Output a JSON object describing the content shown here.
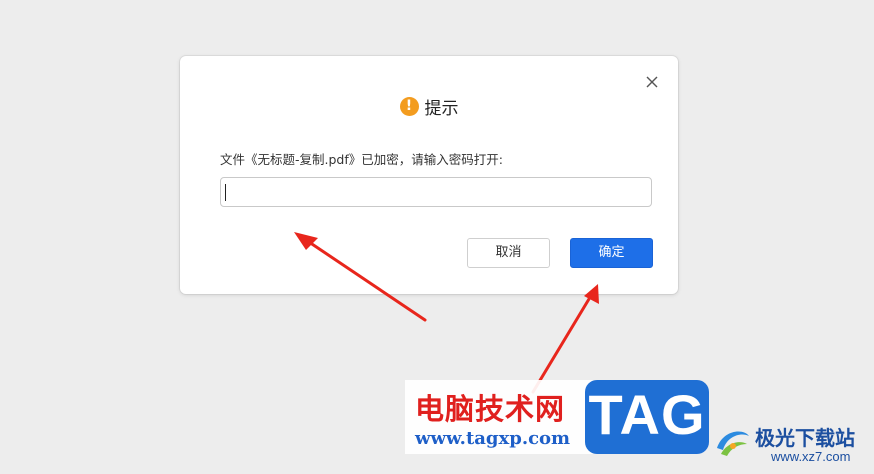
{
  "dialog": {
    "title": "提示",
    "icon": "warning-icon",
    "prompt": "文件《无标题-复制.pdf》已加密，请输入密码打开:",
    "password_value": "",
    "cancel_label": "取消",
    "confirm_label": "确定",
    "close_icon": "close-icon",
    "warning_icon_glyph": "!"
  },
  "colors": {
    "background": "#ededed",
    "dialog": "#ffffff",
    "primary_button": "#1e6fe8",
    "warning": "#f39c1f",
    "annotation_arrow": "#e8261c",
    "watermark_red": "#e0201e",
    "watermark_blue": "#1f6fd4"
  },
  "watermark": {
    "site_name": "电脑技术网",
    "site_url": "www.tagxp.com",
    "tag_text": "TAG",
    "brand_name": "极光下载站",
    "brand_url": "www.xz7.com"
  }
}
